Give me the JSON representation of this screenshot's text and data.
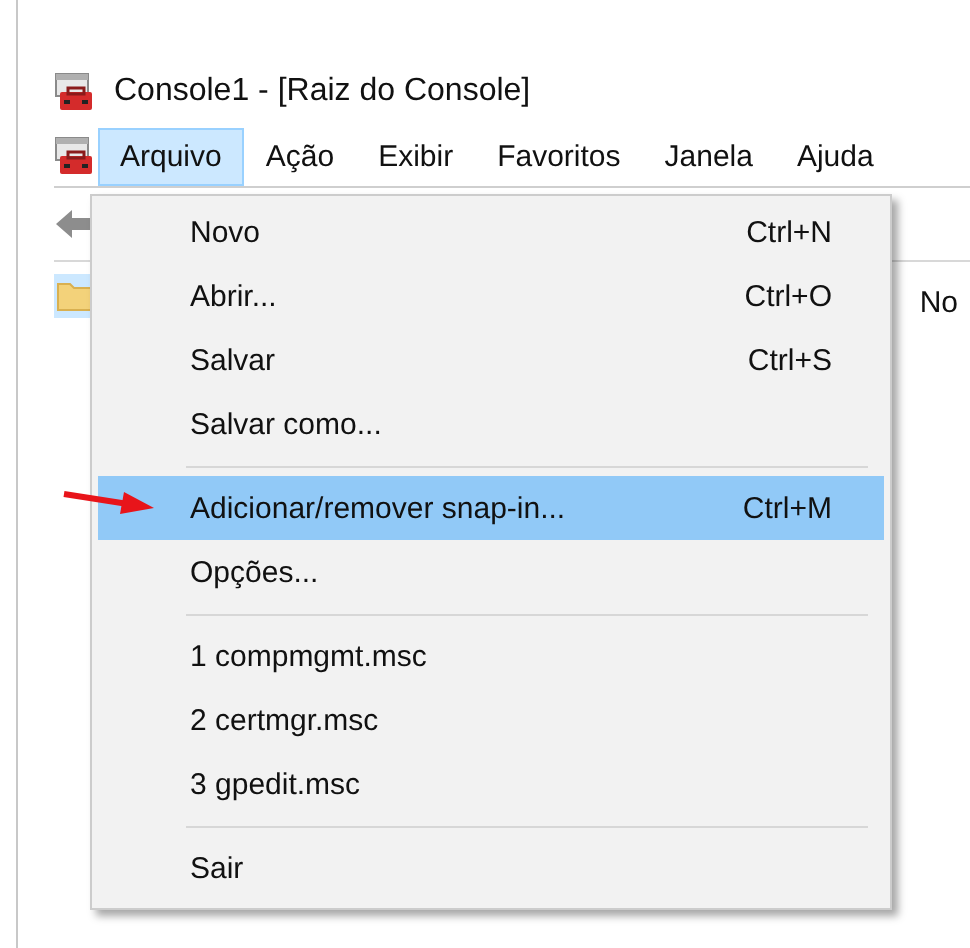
{
  "window": {
    "title": "Console1 - [Raiz do Console]"
  },
  "menu_bar": [
    {
      "label": "Arquivo",
      "selected": true
    },
    {
      "label": "Ação",
      "selected": false
    },
    {
      "label": "Exibir",
      "selected": false
    },
    {
      "label": "Favoritos",
      "selected": false
    },
    {
      "label": "Janela",
      "selected": false
    },
    {
      "label": "Ajuda",
      "selected": false
    }
  ],
  "dropdown": {
    "items": [
      {
        "kind": "item",
        "label": "Novo",
        "shortcut": "Ctrl+N",
        "selected": false
      },
      {
        "kind": "item",
        "label": "Abrir...",
        "shortcut": "Ctrl+O",
        "selected": false
      },
      {
        "kind": "item",
        "label": "Salvar",
        "shortcut": "Ctrl+S",
        "selected": false
      },
      {
        "kind": "item",
        "label": "Salvar como...",
        "selected": false
      },
      {
        "kind": "separator"
      },
      {
        "kind": "item",
        "label": "Adicionar/remover snap-in...",
        "shortcut": "Ctrl+M",
        "selected": true
      },
      {
        "kind": "item",
        "label": "Opções...",
        "selected": false
      },
      {
        "kind": "separator"
      },
      {
        "kind": "item",
        "label": "1 compmgmt.msc",
        "selected": false
      },
      {
        "kind": "item",
        "label": "2 certmgr.msc",
        "selected": false
      },
      {
        "kind": "item",
        "label": "3 gpedit.msc",
        "selected": false
      },
      {
        "kind": "separator"
      },
      {
        "kind": "item",
        "label": "Sair",
        "selected": false
      }
    ]
  },
  "content": {
    "column_header": "No"
  }
}
